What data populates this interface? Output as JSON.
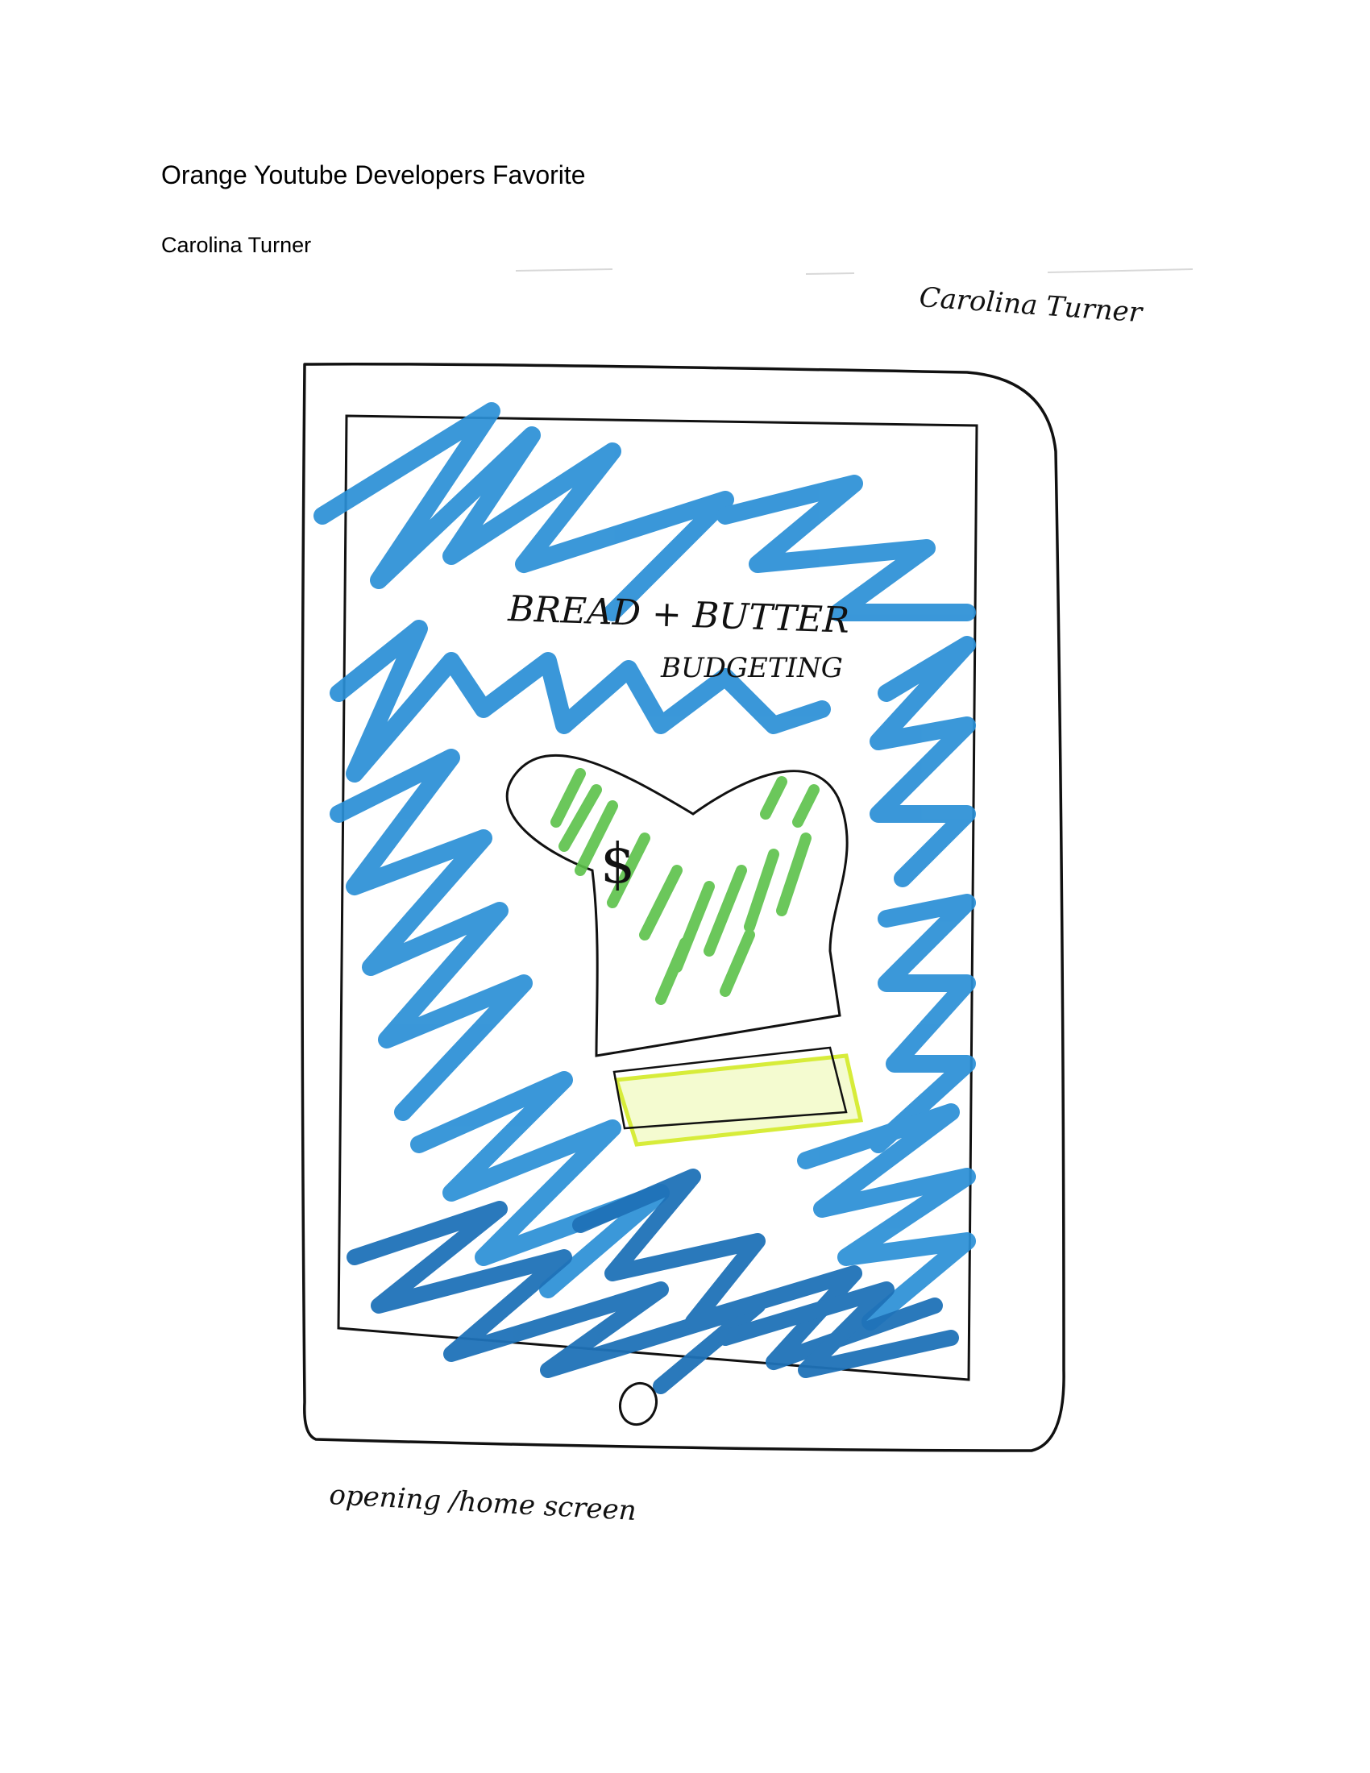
{
  "document": {
    "title": "Orange Youtube Developers Favorite",
    "author": "Carolina Turner"
  },
  "sketch": {
    "signature": "Carolina Turner",
    "app_title_line1": "BREAD + BUTTER",
    "app_title_line2": "BUDGETING",
    "logo_symbol": "$",
    "caption": "opening /home screen",
    "colors": {
      "scribble": "#2a8fd6",
      "scribble_dark": "#1f72b8",
      "logo_fill": "#5cc24a",
      "logo_accent": "#d7ec3a",
      "ink": "#111111"
    }
  }
}
